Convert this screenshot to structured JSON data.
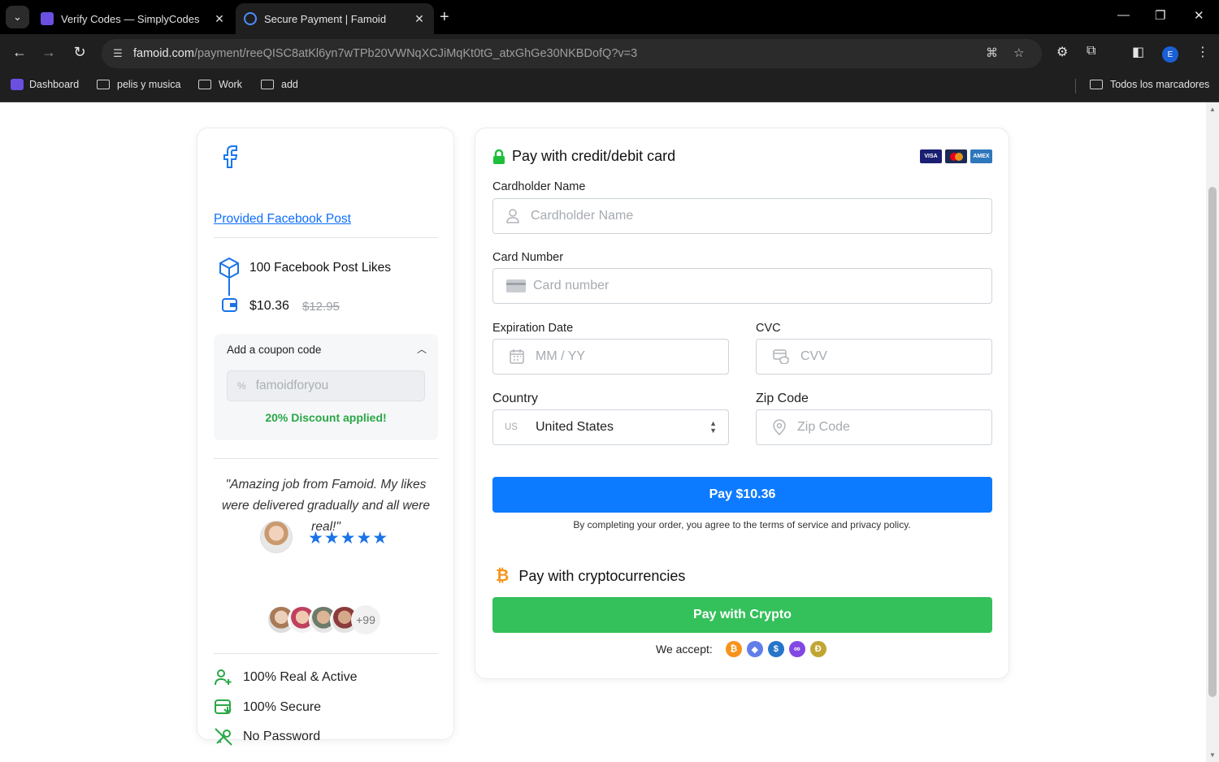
{
  "browser": {
    "tabs": [
      {
        "title": "Verify Codes — SimplyCodes",
        "active": false
      },
      {
        "title": "Secure Payment | Famoid",
        "active": true
      }
    ],
    "url_host": "famoid.com",
    "url_path": "/payment/reeQISC8atKl6yn7wTPb20VWNqXCJiMqKt0tG_atxGhGe30NKBDofQ?v=3",
    "profile_initial": "E",
    "bookmarks": [
      "Dashboard",
      "pelis y musica",
      "Work",
      "add"
    ],
    "all_bookmarks": "Todos los marcadores"
  },
  "order": {
    "post_link": "Provided Facebook Post",
    "service": "100 Facebook Post Likes",
    "price": "$10.36",
    "old_price": "$12.95",
    "coupon_title": "Add a coupon code",
    "coupon_value": "famoidforyou",
    "coupon_status": "20% Discount applied!",
    "review": "\"Amazing job from Famoid. My likes were delivered gradually and all were real!\"",
    "stars": "★★★★★",
    "more_users": "+99",
    "features": [
      "100% Real & Active",
      "100% Secure",
      "No Password"
    ]
  },
  "payment": {
    "title": "Pay with credit/debit card",
    "card_brands": [
      "VISA",
      "MC",
      "AMEX"
    ],
    "cardholder_label": "Cardholder Name",
    "cardholder_placeholder": "Cardholder Name",
    "card_number_label": "Card Number",
    "card_number_placeholder": "Card number",
    "expiry_label": "Expiration Date",
    "expiry_placeholder": "MM / YY",
    "cvc_label": "CVC",
    "cvc_placeholder": "CVV",
    "country_label": "Country",
    "country_code": "US",
    "country_value": "United States",
    "zip_label": "Zip Code",
    "zip_placeholder": "Zip Code",
    "pay_button": "Pay $10.36",
    "terms": "By completing your order, you agree to the terms of service and privacy policy.",
    "crypto_title": "Pay with cryptocurrencies",
    "crypto_button": "Pay with Crypto",
    "accept_label": "We accept:",
    "coins": [
      {
        "symbol": "₿",
        "color": "#f7931a"
      },
      {
        "symbol": "◆",
        "color": "#627eea"
      },
      {
        "symbol": "$",
        "color": "#2775ca"
      },
      {
        "symbol": "∞",
        "color": "#8247e5"
      },
      {
        "symbol": "Ð",
        "color": "#c2a633"
      }
    ]
  },
  "colors": {
    "primary": "#0d7bff",
    "success": "#34c05a",
    "link": "#0d6efd",
    "star": "#1a73e8"
  }
}
